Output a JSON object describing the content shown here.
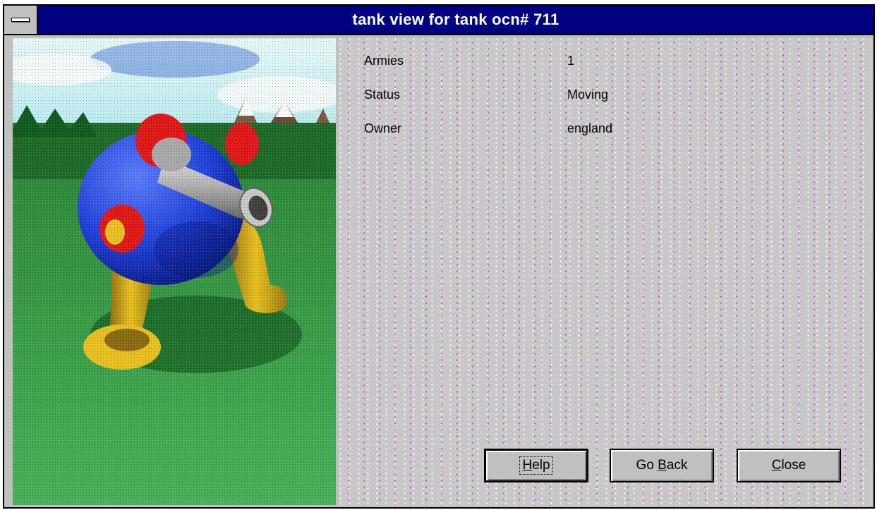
{
  "window": {
    "title": "tank view for tank ocn# 711"
  },
  "info": {
    "rows": [
      {
        "label": "Armies",
        "value": "1"
      },
      {
        "label": "Status",
        "value": "Moving"
      },
      {
        "label": "Owner",
        "value": "england"
      }
    ]
  },
  "buttons": {
    "help": {
      "label": "Help",
      "mnemonic": "H"
    },
    "go_back": {
      "label_prefix": "Go ",
      "mnemonic": "B",
      "label_suffix": "ack",
      "label": "Go Back"
    },
    "close": {
      "mnemonic": "C",
      "label_suffix": "lose",
      "label": "Close"
    }
  },
  "picture": {
    "subject": "tank-illustration"
  },
  "colors": {
    "titlebar": "#000080",
    "face": "#c0c0c0",
    "tank_body": "#1e3fd8",
    "tank_accent": "#e01818",
    "tank_legs": "#e8c020",
    "barrel": "#a8a8a8",
    "grass": "#3aa04a",
    "sky": "#bfeef0"
  }
}
